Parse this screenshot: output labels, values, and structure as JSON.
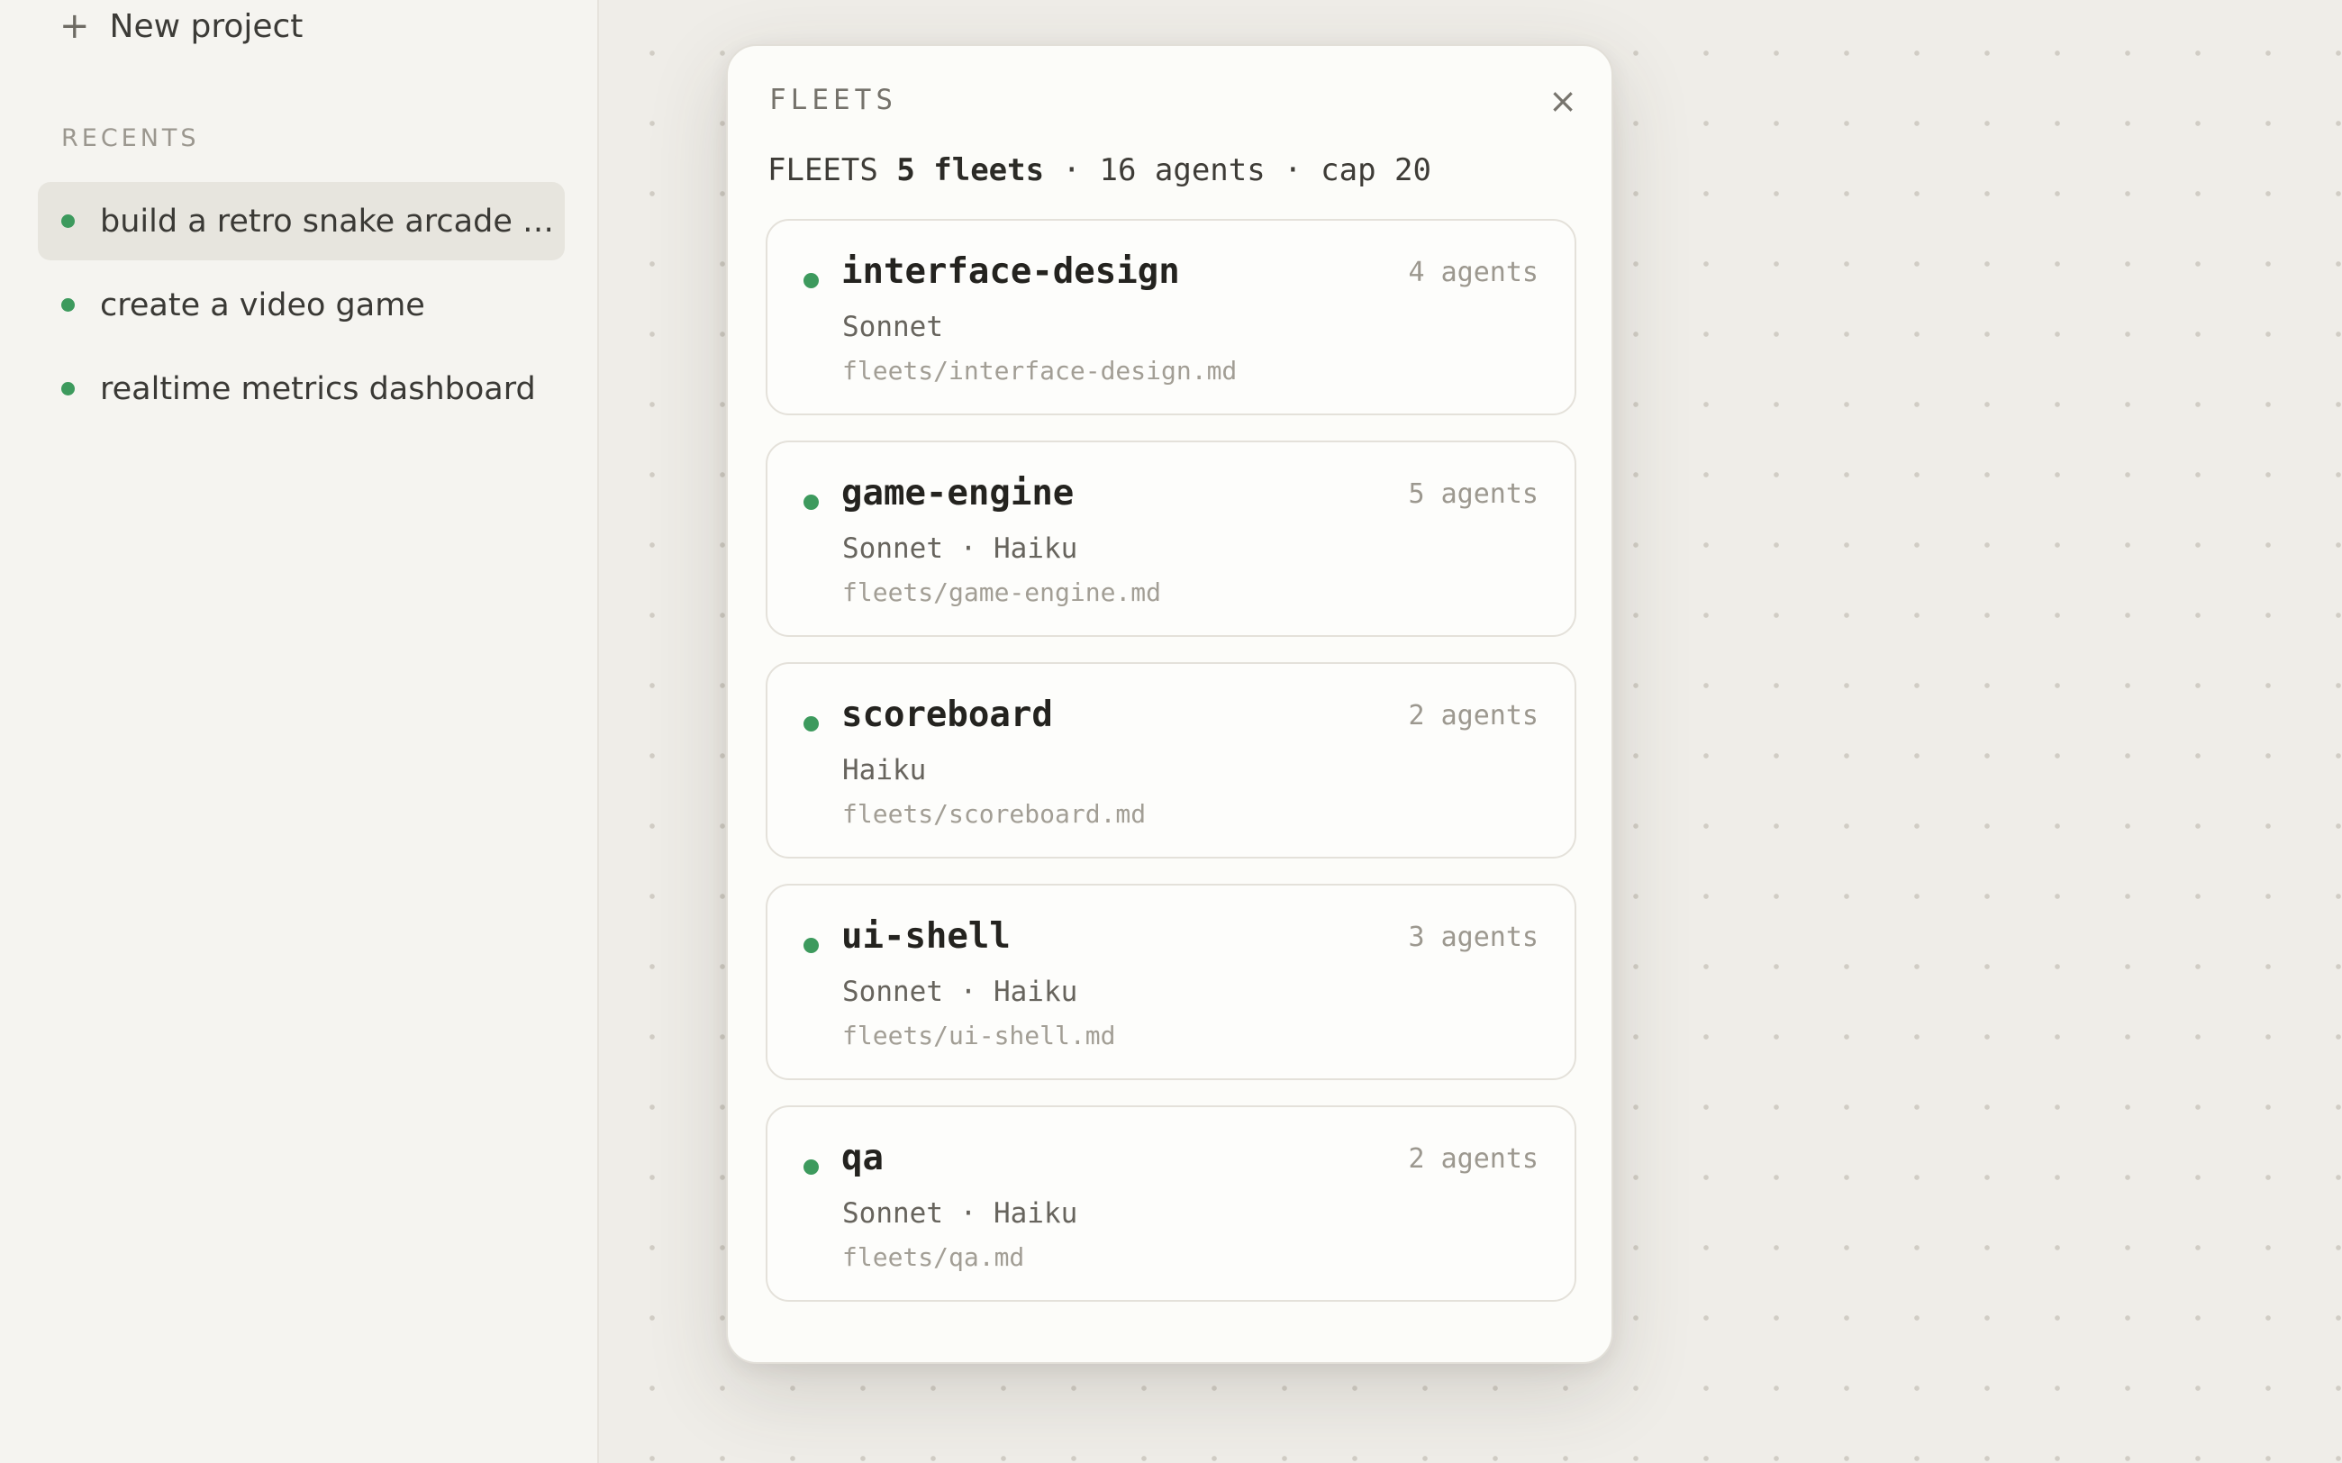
{
  "sidebar": {
    "new_project_label": "New project",
    "recents_label": "RECENTS",
    "recents": [
      {
        "label": "build a retro snake arcade g..."
      },
      {
        "label": "create a video game"
      },
      {
        "label": "realtime metrics dashboard"
      }
    ]
  },
  "modal": {
    "title": "FLEETS",
    "close_icon": "close-icon",
    "summary": {
      "prefix": "FLEETS",
      "fleets": "5 fleets",
      "rest": " · 16 agents · cap 20"
    },
    "fleets": [
      {
        "name": "interface-design",
        "agents": "4 agents",
        "models": "Sonnet",
        "path": "fleets/interface-design.md"
      },
      {
        "name": "game-engine",
        "agents": "5 agents",
        "models": "Sonnet · Haiku",
        "path": "fleets/game-engine.md"
      },
      {
        "name": "scoreboard",
        "agents": "2 agents",
        "models": "Haiku",
        "path": "fleets/scoreboard.md"
      },
      {
        "name": "ui-shell",
        "agents": "3 agents",
        "models": "Sonnet · Haiku",
        "path": "fleets/ui-shell.md"
      },
      {
        "name": "qa",
        "agents": "2 agents",
        "models": "Sonnet · Haiku",
        "path": "fleets/qa.md"
      }
    ]
  },
  "colors": {
    "status_dot": "#3d9a5d",
    "background": "#efede8",
    "sidebar": "#f5f4f0"
  }
}
